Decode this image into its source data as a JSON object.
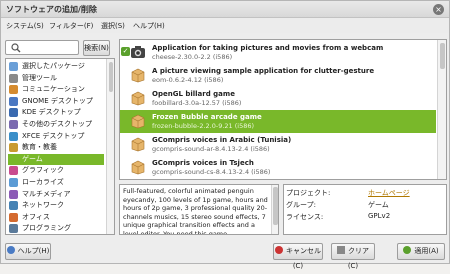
{
  "window": {
    "title": "ソフトウェアの追加/削除",
    "close": "×"
  },
  "menu": [
    "システム(S)",
    "フィルター(F)",
    "選択(S)",
    "ヘルプ(H)"
  ],
  "search": {
    "placeholder": "",
    "button": "検索(N)"
  },
  "categories": [
    "選択したパッケージ",
    "管理ツール",
    "コミュニケーション",
    "GNOME デスクトップ",
    "KDE デスクトップ",
    "その他のデスクトップ",
    "XFCE デスクトップ",
    "教育・教養",
    "ゲーム",
    "グラフィック",
    "ローカライズ",
    "マルチメディア",
    "ネットワーク",
    "オフィス",
    "プログラミング"
  ],
  "selected_category_index": 8,
  "packages": [
    {
      "title": "Application for taking pictures and movies from a webcam",
      "sub": "cheese-2.30.0-2.2 (i586)",
      "installed": true,
      "icon": "camera-icon"
    },
    {
      "title": "A picture viewing sample application for clutter-gesture",
      "sub": "eom-0.6.2-4.12 (i586)",
      "installed": false,
      "icon": "package-icon"
    },
    {
      "title": "OpenGL billard game",
      "sub": "foobillard-3.0a-12.57 (i586)",
      "installed": false,
      "icon": "package-icon"
    },
    {
      "title": "Frozen Bubble arcade game",
      "sub": "frozen-bubble-2.2.0-9.21 (i586)",
      "installed": false,
      "icon": "package-icon"
    },
    {
      "title": "GCompris voices in Arabic (Tunisia)",
      "sub": "gcompris-sound-ar-8.4.13-2.4 (i586)",
      "installed": false,
      "icon": "package-icon"
    },
    {
      "title": "GCompris voices in Tsjech",
      "sub": "gcompris-sound-cs-8.4.13-2.4 (i586)",
      "installed": false,
      "icon": "package-icon"
    }
  ],
  "selected_package_index": 3,
  "description": "Full-featured, colorful animated penguin eyecandy, 100 levels of 1p game, hours and hours of 2p game, 3 professional quality 20-channels musics, 15 stereo sound effects, 7 unique graphical transition effects and a level editor. You need this game.",
  "properties": [
    {
      "label": "プロジェクト:",
      "value": "ホームページ",
      "link": true
    },
    {
      "label": "グループ:",
      "value": "ゲーム",
      "link": false
    },
    {
      "label": "ライセンス:",
      "value": "GPLv2",
      "link": false
    }
  ],
  "buttons": {
    "help": "ヘルプ(H)",
    "cancel": "キャンセル(C)",
    "clear": "クリア(C)",
    "apply": "適用(A)"
  },
  "colors": {
    "selection": "#79b82a",
    "link": "#b07800"
  }
}
